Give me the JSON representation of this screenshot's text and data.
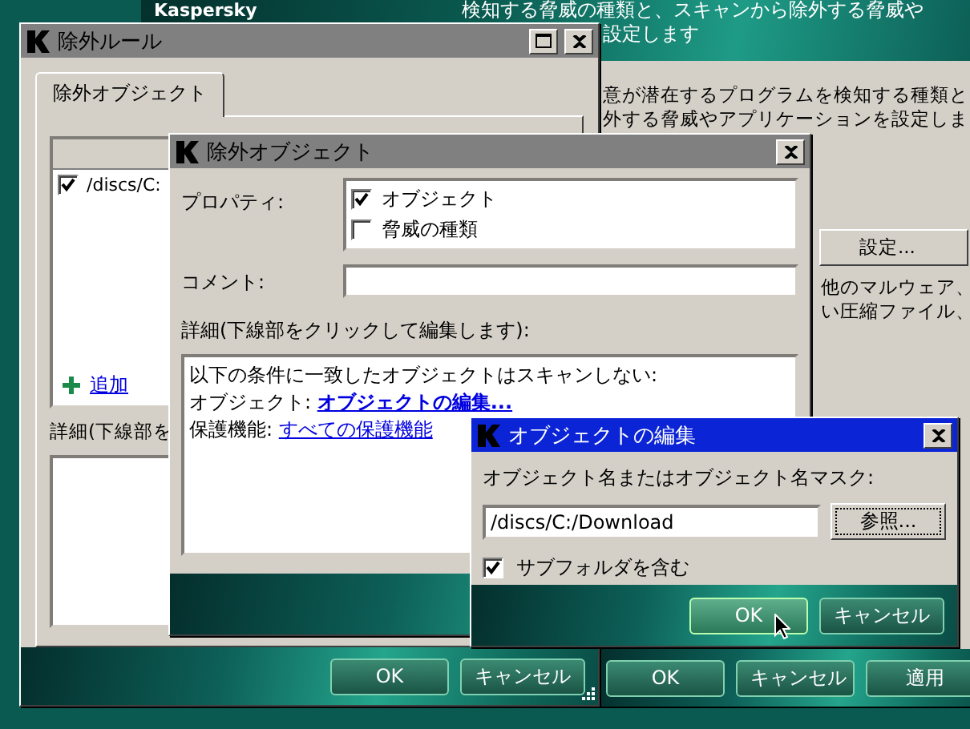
{
  "background_window": {
    "brand": "Kaspersky",
    "header_lines": [
      "検知する脅威の種類と、スキャンから除外する脅威や",
      "設定します"
    ],
    "body_lines": [
      "意が潜在するプログラムを検知する種類と",
      "外する脅威やアプリケーションを設定しま"
    ],
    "settings_button": "設定...",
    "more_lines": [
      "他のマルウェア、",
      "い圧縮ファイル、"
    ],
    "buttons": [
      "OK",
      "キャンセル",
      "適用"
    ]
  },
  "exclusion_rules_window": {
    "title": "除外ルール",
    "active": false,
    "tabs": [
      {
        "label": "除外オブジェクト",
        "selected": true
      }
    ],
    "rows": [
      {
        "label": "/discs/C:",
        "checked": true
      }
    ],
    "add_link": "追加",
    "details_label": "詳細(下線部を",
    "buttons": [
      "OK",
      "キャンセル"
    ]
  },
  "exclusion_object_window": {
    "title": "除外オブジェクト",
    "active": false,
    "properties_label": "プロパティ:",
    "properties": [
      {
        "label": "オブジェクト",
        "checked": true
      },
      {
        "label": "脅威の種類",
        "checked": false
      }
    ],
    "comment_label": "コメント:",
    "details_label": "詳細(下線部をクリックして編集します):",
    "details_intro": "以下の条件に一致したオブジェクトはスキャンしない:",
    "details_lines": [
      {
        "label": "オブジェクト:",
        "link": "オブジェクトの編集...",
        "bold": true
      },
      {
        "label": "保護機能:",
        "link": "すべての保護機能",
        "bold": false
      }
    ]
  },
  "edit_object_window": {
    "title": "オブジェクトの編集",
    "active": true,
    "mask_label": "オブジェクト名またはオブジェクト名マスク:",
    "value": "/discs/C:/Download",
    "browse_button": "参照...",
    "include_subfolders": {
      "label": "サブフォルダを含む",
      "checked": true
    },
    "buttons": [
      {
        "label": "OK",
        "default": true
      },
      {
        "label": "キャンセル",
        "default": false
      }
    ]
  }
}
